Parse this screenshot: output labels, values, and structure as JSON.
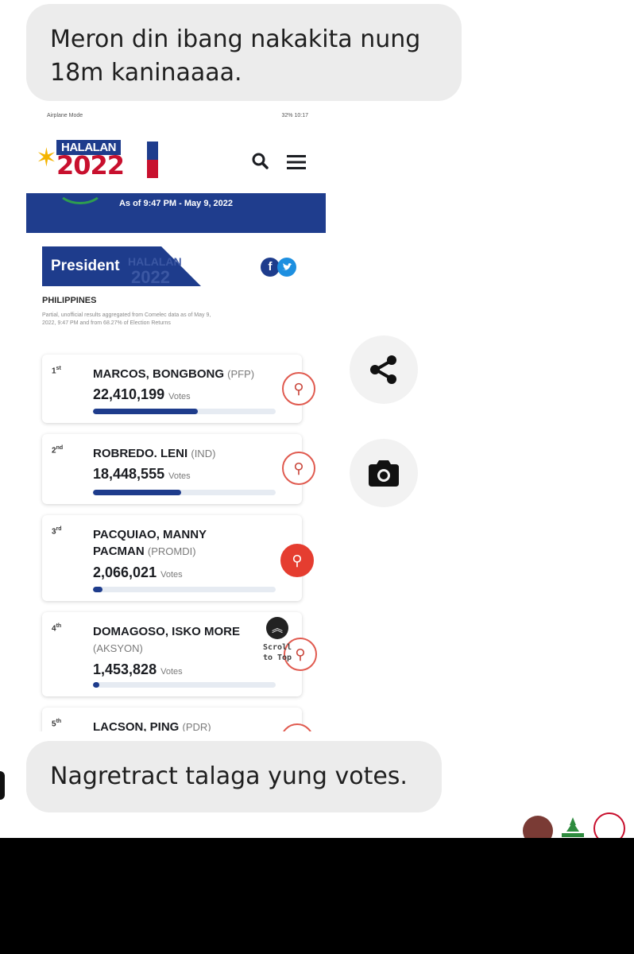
{
  "messages": {
    "first": "Meron din ibang nakakita nung 18m kaninaaaa.",
    "second": "Nagretract talaga yung votes."
  },
  "phone": {
    "status_left": "Airplane Mode",
    "status_right": "32% 10:17",
    "logo": {
      "top": "HALALAN",
      "year": "2022"
    },
    "banner_text": "As of 9:47 PM - May 9, 2022",
    "section_title": "President",
    "watermark": "HALALAN 2022",
    "region": "PHILIPPINES",
    "note": "Partial, unofficial results aggregated from Comelec data as of May 9, 2022, 9:47 PM and from 68.27% of Election Returns",
    "vote_label": "Votes",
    "scroll_top": {
      "line1": "Scroll",
      "line2": "to Top"
    },
    "candidates": [
      {
        "rank": "1",
        "suffix": "st",
        "name": "MARCOS, BONGBONG",
        "party": "(PFP)",
        "votes": "22,410,199",
        "share": 0.574
      },
      {
        "rank": "2",
        "suffix": "nd",
        "name": "ROBREDO. LENI",
        "party": "(IND)",
        "votes": "18,448,555",
        "share": 0.483
      },
      {
        "rank": "3",
        "suffix": "rd",
        "name": "PACQUIAO, MANNY",
        "name2": "PACMAN",
        "party": "(PROMDI)",
        "votes": "2,066,021",
        "share": 0.05
      },
      {
        "rank": "4",
        "suffix": "th",
        "name": "DOMAGOSO, ISKO MORE",
        "party": "(AKSYON)",
        "votes": "1,453,828",
        "share": 0.035
      },
      {
        "rank": "5",
        "suffix": "th",
        "name": "LACSON, PING",
        "party": "(PDR)"
      }
    ]
  },
  "icons": {
    "share": "share-icon",
    "camera": "camera-icon",
    "search": "search-icon",
    "menu": "hamburger-menu-icon"
  },
  "colors": {
    "navy": "#1e3c8c",
    "red": "#c8102e",
    "bubble": "#ececec"
  }
}
